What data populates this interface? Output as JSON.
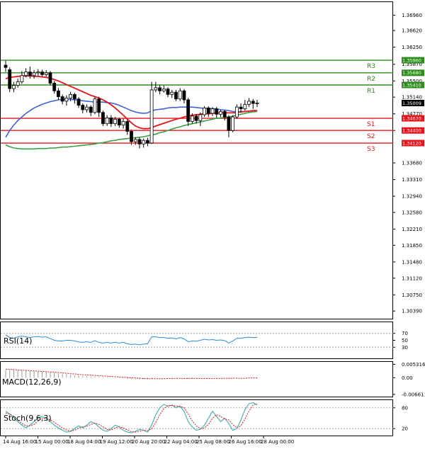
{
  "chart_data": {
    "type": "candlestick",
    "price_axis": {
      "ticks": [
        "1.36960",
        "1.36620",
        "1.36250",
        "1.35870",
        "1.35500",
        "1.35140",
        "1.34770",
        "1.34400",
        "1.33680",
        "1.33310",
        "1.32940",
        "1.32580",
        "1.32210",
        "1.31850",
        "1.31480",
        "1.31120",
        "1.30750",
        "1.30390"
      ],
      "range": [
        1.3022,
        1.3725
      ]
    },
    "time_axis": {
      "labels": [
        "14 Aug 16:00",
        "15 Aug 00:00",
        "18 Aug 04:00",
        "19 Aug 12:00",
        "20 Aug 20:00",
        "22 Aug 04:00",
        "25 Aug 08:00",
        "26 Aug 16:00",
        "28 Aug 00:00"
      ]
    },
    "levels": [
      {
        "name": "R3",
        "value": 1.3596,
        "tag": "1.35960",
        "color": "#2e8b1e"
      },
      {
        "name": "R2",
        "value": 1.3568,
        "tag": "1.35680",
        "color": "#2e8b1e"
      },
      {
        "name": "R1",
        "value": 1.3541,
        "tag": "1.35410",
        "color": "#2e8b1e"
      },
      {
        "name": "S1",
        "value": 1.3467,
        "tag": "1.34670",
        "color": "#e8141b"
      },
      {
        "name": "S2",
        "value": 1.344,
        "tag": "1.34400",
        "color": "#e8141b"
      },
      {
        "name": "S3",
        "value": 1.3412,
        "tag": "1.34120",
        "color": "#e8141b"
      }
    ],
    "current_price": {
      "value": 1.35009,
      "tag": "1.35009"
    },
    "candles": [
      [
        1.3585,
        1.358,
        1.3595,
        1.357
      ],
      [
        1.3575,
        1.3533,
        1.358,
        1.3525
      ],
      [
        1.3533,
        1.354,
        1.3548,
        1.3525
      ],
      [
        1.354,
        1.3548,
        1.3555,
        1.3535
      ],
      [
        1.3548,
        1.3562,
        1.3572,
        1.3544
      ],
      [
        1.3562,
        1.357,
        1.3578,
        1.3558
      ],
      [
        1.357,
        1.3562,
        1.3582,
        1.3555
      ],
      [
        1.3562,
        1.3568,
        1.3574,
        1.3555
      ],
      [
        1.3568,
        1.357,
        1.3576,
        1.356
      ],
      [
        1.357,
        1.3564,
        1.3575,
        1.3558
      ],
      [
        1.3564,
        1.3568,
        1.3574,
        1.356
      ],
      [
        1.3568,
        1.3545,
        1.3572,
        1.354
      ],
      [
        1.3545,
        1.3528,
        1.355,
        1.3522
      ],
      [
        1.3528,
        1.3515,
        1.3534,
        1.3508
      ],
      [
        1.3515,
        1.3505,
        1.352,
        1.3498
      ],
      [
        1.3505,
        1.3512,
        1.3518,
        1.3495
      ],
      [
        1.3512,
        1.352,
        1.3526,
        1.3505
      ],
      [
        1.352,
        1.351,
        1.3524,
        1.35
      ],
      [
        1.351,
        1.3496,
        1.3514,
        1.349
      ],
      [
        1.3496,
        1.3486,
        1.35,
        1.3478
      ],
      [
        1.3486,
        1.3492,
        1.3498,
        1.348
      ],
      [
        1.3492,
        1.348,
        1.3496,
        1.3472
      ],
      [
        1.348,
        1.351,
        1.3514,
        1.3476
      ],
      [
        1.351,
        1.348,
        1.3515,
        1.347
      ],
      [
        1.348,
        1.3455,
        1.3484,
        1.345
      ],
      [
        1.3455,
        1.3468,
        1.3474,
        1.345
      ],
      [
        1.3468,
        1.3455,
        1.3474,
        1.3448
      ],
      [
        1.3455,
        1.3465,
        1.347,
        1.345
      ],
      [
        1.3465,
        1.3452,
        1.3468,
        1.3446
      ],
      [
        1.3452,
        1.346,
        1.3466,
        1.3444
      ],
      [
        1.346,
        1.3438,
        1.3464,
        1.343
      ],
      [
        1.3438,
        1.3415,
        1.3442,
        1.3408
      ],
      [
        1.3415,
        1.342,
        1.3425,
        1.3408
      ],
      [
        1.342,
        1.341,
        1.3424,
        1.34
      ],
      [
        1.341,
        1.3418,
        1.3422,
        1.3402
      ],
      [
        1.3418,
        1.3412,
        1.3424,
        1.3405
      ],
      [
        1.3412,
        1.353,
        1.3548,
        1.341
      ],
      [
        1.353,
        1.3535,
        1.3548,
        1.3525
      ],
      [
        1.3535,
        1.3528,
        1.3542,
        1.352
      ],
      [
        1.3528,
        1.3532,
        1.354,
        1.3524
      ],
      [
        1.3532,
        1.352,
        1.3536,
        1.3514
      ],
      [
        1.352,
        1.3525,
        1.353,
        1.3512
      ],
      [
        1.3525,
        1.351,
        1.353,
        1.3505
      ],
      [
        1.351,
        1.3528,
        1.3534,
        1.3505
      ],
      [
        1.3528,
        1.3508,
        1.3532,
        1.35
      ],
      [
        1.3508,
        1.346,
        1.3512,
        1.345
      ],
      [
        1.346,
        1.3472,
        1.3478,
        1.3455
      ],
      [
        1.3472,
        1.3462,
        1.3476,
        1.3455
      ],
      [
        1.3462,
        1.3475,
        1.348,
        1.345
      ],
      [
        1.3475,
        1.349,
        1.3494,
        1.347
      ],
      [
        1.349,
        1.3478,
        1.3494,
        1.347
      ],
      [
        1.3478,
        1.3488,
        1.3492,
        1.3472
      ],
      [
        1.3488,
        1.3476,
        1.3492,
        1.3468
      ],
      [
        1.3476,
        1.3482,
        1.3486,
        1.347
      ],
      [
        1.3482,
        1.347,
        1.3486,
        1.3462
      ],
      [
        1.347,
        1.344,
        1.3474,
        1.3425
      ],
      [
        1.344,
        1.347,
        1.3474,
        1.3436
      ],
      [
        1.347,
        1.3492,
        1.3498,
        1.3466
      ],
      [
        1.3492,
        1.3488,
        1.35,
        1.348
      ],
      [
        1.3488,
        1.3498,
        1.3508,
        1.3484
      ],
      [
        1.3498,
        1.3505,
        1.3512,
        1.3492
      ],
      [
        1.3505,
        1.35,
        1.351,
        1.3488
      ],
      [
        1.35,
        1.3501,
        1.3508,
        1.3492
      ]
    ],
    "ma_slow_blue": [
      1.3425,
      1.344,
      1.3452,
      1.3462,
      1.347,
      1.3478,
      1.3484,
      1.349,
      1.3494,
      1.3498,
      1.3501,
      1.3504,
      1.3506,
      1.3508,
      1.3509,
      1.3509,
      1.3509,
      1.3508,
      1.3507,
      1.3506,
      1.3505,
      1.3504,
      1.3503,
      1.3503,
      1.3503,
      1.3502,
      1.3501,
      1.3499,
      1.3496,
      1.3492,
      1.3488,
      1.3484,
      1.3481,
      1.3479,
      1.3478,
      1.3479,
      1.3484,
      1.3486,
      1.3487,
      1.3488,
      1.349,
      1.3491,
      1.3491,
      1.3492,
      1.3492,
      1.3492,
      1.3492,
      1.3491,
      1.349,
      1.3489,
      1.3489,
      1.3488,
      1.3488,
      1.3486,
      1.3485,
      1.3484,
      1.3482,
      1.3482,
      1.3482,
      1.3482,
      1.3483,
      1.3484,
      1.3484
    ],
    "ma_mid_red": [
      1.3555,
      1.3558,
      1.3559,
      1.356,
      1.3561,
      1.3561,
      1.3561,
      1.356,
      1.356,
      1.3559,
      1.3558,
      1.3556,
      1.3553,
      1.355,
      1.3546,
      1.3542,
      1.3538,
      1.3534,
      1.353,
      1.3526,
      1.3522,
      1.3518,
      1.3515,
      1.3512,
      1.3508,
      1.3503,
      1.3497,
      1.349,
      1.3482,
      1.3474,
      1.3465,
      1.3457,
      1.345,
      1.3446,
      1.3444,
      1.3444,
      1.3446,
      1.345,
      1.3453,
      1.3456,
      1.3459,
      1.3462,
      1.3465,
      1.3467,
      1.347,
      1.3472,
      1.3474,
      1.3475,
      1.3476,
      1.3477,
      1.3477,
      1.3478,
      1.3479,
      1.3479,
      1.3479,
      1.3479,
      1.3479,
      1.348,
      1.3481,
      1.3482,
      1.3483,
      1.3484,
      1.3484
    ],
    "ma_fast_green": [
      1.3408,
      1.3404,
      1.3401,
      1.34,
      1.3399,
      1.3399,
      1.3399,
      1.3399,
      1.34,
      1.34,
      1.34,
      1.3401,
      1.3401,
      1.3402,
      1.3403,
      1.3403,
      1.3404,
      1.3405,
      1.3406,
      1.3407,
      1.3408,
      1.3409,
      1.341,
      1.3412,
      1.3413,
      1.3415,
      1.3417,
      1.3418,
      1.342,
      1.3421,
      1.3422,
      1.3423,
      1.3424,
      1.3425,
      1.3426,
      1.3428,
      1.343,
      1.3432,
      1.3435,
      1.3437,
      1.344,
      1.3443,
      1.3446,
      1.3448,
      1.3451,
      1.3453,
      1.3455,
      1.3457,
      1.3459,
      1.3461,
      1.3463,
      1.3465,
      1.3467,
      1.3468,
      1.3469,
      1.347,
      1.3472,
      1.3474,
      1.3476,
      1.3478,
      1.348,
      1.3481,
      1.3482
    ],
    "rsi": {
      "label": "RSI(14)",
      "ticks": [
        "70",
        "50",
        "30"
      ],
      "range": [
        0,
        100
      ],
      "values": [
        66,
        58,
        56,
        60,
        62,
        60,
        58,
        60,
        61,
        59,
        60,
        55,
        50,
        48,
        48,
        50,
        50,
        48,
        45,
        44,
        46,
        44,
        49,
        44,
        42,
        44,
        42,
        44,
        42,
        44,
        40,
        38,
        39,
        37,
        39,
        40,
        60,
        60,
        58,
        58,
        56,
        57,
        54,
        58,
        54,
        46,
        48,
        47,
        50,
        53,
        51,
        52,
        50,
        51,
        49,
        42,
        48,
        56,
        56,
        58,
        59,
        58,
        58
      ]
    },
    "macd": {
      "label": "MACD(12,26,9)",
      "ticks": [
        "0.005316",
        "0.00",
        "-0.006611"
      ],
      "range": [
        -0.0072,
        0.006
      ],
      "histogram": [
        0.003,
        0.0031,
        0.0031,
        0.003,
        0.0029,
        0.0028,
        0.0027,
        0.0026,
        0.0025,
        0.0024,
        0.0023,
        0.0022,
        0.002,
        0.0018,
        0.0016,
        0.0014,
        0.0012,
        0.001,
        0.0008,
        0.0007,
        0.0006,
        0.0005,
        0.0004,
        0.0003,
        0.0002,
        0.0001,
        0.0,
        -0.0001,
        -0.0002,
        -0.0003,
        -0.0004,
        -0.0005,
        -0.0006,
        -0.0006,
        -0.0006,
        -0.0005,
        -0.0003,
        -0.0002,
        -0.0001,
        -0.0001,
        -0.0001,
        -0.0001,
        -0.0001,
        -0.0001,
        -0.0001,
        -0.0002,
        -0.0002,
        -0.0002,
        -0.0002,
        -0.0001,
        -0.0001,
        -0.0001,
        -0.0001,
        -0.0001,
        -0.0001,
        -0.0002,
        -0.0002,
        -0.0001,
        0.0,
        0.0,
        0.0001,
        0.0001,
        0.0001
      ],
      "signal": [
        0.0034,
        0.0033,
        0.0032,
        0.0031,
        0.003,
        0.0029,
        0.0028,
        0.0027,
        0.0026,
        0.0025,
        0.0024,
        0.0023,
        0.0022,
        0.0021,
        0.0019,
        0.0018,
        0.0016,
        0.0015,
        0.0013,
        0.0012,
        0.0011,
        0.001,
        0.0009,
        0.0008,
        0.0007,
        0.0006,
        0.0005,
        0.0004,
        0.0003,
        0.0002,
        0.0001,
        0.0,
        -0.0001,
        -0.0002,
        -0.0003,
        -0.0004,
        -0.0004,
        -0.0004,
        -0.0004,
        -0.0004,
        -0.0003,
        -0.0003,
        -0.0003,
        -0.0003,
        -0.0003,
        -0.0003,
        -0.0003,
        -0.0003,
        -0.0003,
        -0.0003,
        -0.0003,
        -0.0003,
        -0.0003,
        -0.0003,
        -0.0002,
        -0.0002,
        -0.0002,
        -0.0002,
        -0.0002,
        -0.0002,
        -0.0001,
        -0.0001,
        -0.0001
      ]
    },
    "stoch": {
      "label": "Stoch(9,6,3)",
      "ticks": [
        "80",
        "20"
      ],
      "range": [
        0,
        100
      ],
      "main": [
        70,
        62,
        50,
        40,
        30,
        22,
        30,
        40,
        50,
        55,
        48,
        40,
        30,
        22,
        15,
        10,
        12,
        20,
        28,
        22,
        30,
        40,
        35,
        25,
        15,
        12,
        20,
        30,
        25,
        15,
        10,
        8,
        12,
        18,
        15,
        10,
        30,
        60,
        80,
        90,
        85,
        88,
        80,
        85,
        70,
        40,
        25,
        15,
        18,
        30,
        50,
        70,
        55,
        40,
        50,
        35,
        15,
        20,
        45,
        75,
        92,
        95,
        88
      ],
      "signal": [
        65,
        62,
        55,
        45,
        35,
        28,
        28,
        32,
        42,
        50,
        50,
        45,
        38,
        30,
        22,
        16,
        13,
        15,
        22,
        25,
        27,
        32,
        36,
        32,
        25,
        18,
        16,
        22,
        25,
        22,
        16,
        11,
        10,
        13,
        15,
        14,
        20,
        38,
        60,
        78,
        86,
        87,
        85,
        84,
        80,
        62,
        42,
        28,
        20,
        22,
        32,
        50,
        60,
        55,
        48,
        45,
        32,
        22,
        28,
        48,
        70,
        88,
        92
      ]
    }
  }
}
